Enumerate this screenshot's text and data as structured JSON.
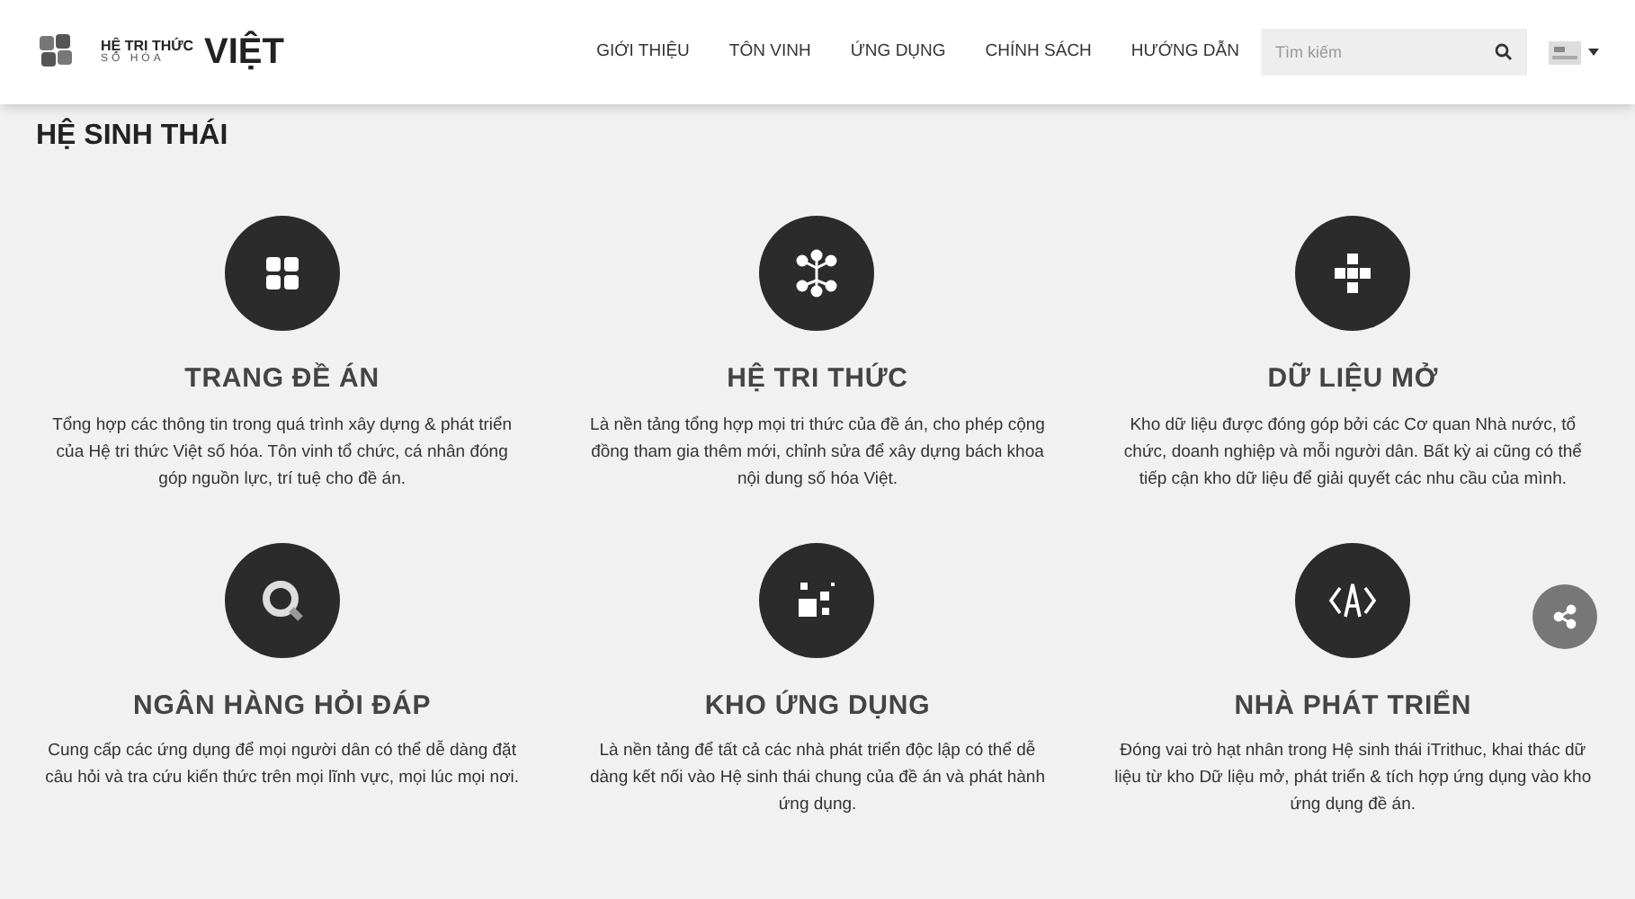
{
  "header": {
    "logo": {
      "line_1": "HỆ TRI THỨC",
      "line_2": "SỐ HÓA",
      "line_3": "VIỆT"
    },
    "nav": [
      "GIỚI THIỆU",
      "TÔN VINH",
      "ỨNG DỤNG",
      "CHÍNH SÁCH",
      "HƯỚNG DẪN"
    ],
    "search": {
      "placeholder": "Tìm kiếm"
    }
  },
  "section": {
    "title": "HỆ SINH THÁI",
    "items": [
      {
        "title": "TRANG ĐỀ ÁN",
        "description": "Tổng hợp các thông tin trong quá trình xây dựng & phát triển của Hệ tri thức Việt số hóa. Tôn vinh tổ chức, cá nhân đóng góp nguồn lực, trí tuệ cho đề án."
      },
      {
        "title": "HỆ TRI THỨC",
        "description": "Là nền tảng tổng hợp mọi tri thức của đề án, cho phép cộng đồng tham gia thêm mới, chỉnh sửa để xây dựng bách khoa nội dung số hóa Việt."
      },
      {
        "title": "DỮ LIỆU MỞ",
        "description": "Kho dữ liệu được đóng góp bởi các Cơ quan Nhà nước, tổ chức, doanh nghiệp và mỗi người dân. Bất kỳ ai cũng có thể tiếp cận kho dữ liệu để giải quyết các nhu cầu của mình."
      },
      {
        "title": "NGÂN HÀNG HỎI ĐÁP",
        "description": "Cung cấp các ứng dụng để mọi người dân có thể dễ dàng đặt câu hỏi và tra cứu kiến thức trên mọi lĩnh vực, mọi lúc mọi nơi."
      },
      {
        "title": "KHO ỨNG DỤNG",
        "description": "Là nền tảng để tất cả các nhà phát triển độc lập có thể dễ dàng kết nối vào Hệ sinh thái chung của đề án và phát hành ứng dụng."
      },
      {
        "title": "NHÀ PHÁT TRIỂN",
        "description": "Đóng vai trò hạt nhân trong Hệ sinh thái iTrithuc, khai thác dữ liệu từ kho Dữ liệu mở, phát triển & tích hợp ứng dụng vào kho ứng dụng đề án."
      }
    ]
  }
}
